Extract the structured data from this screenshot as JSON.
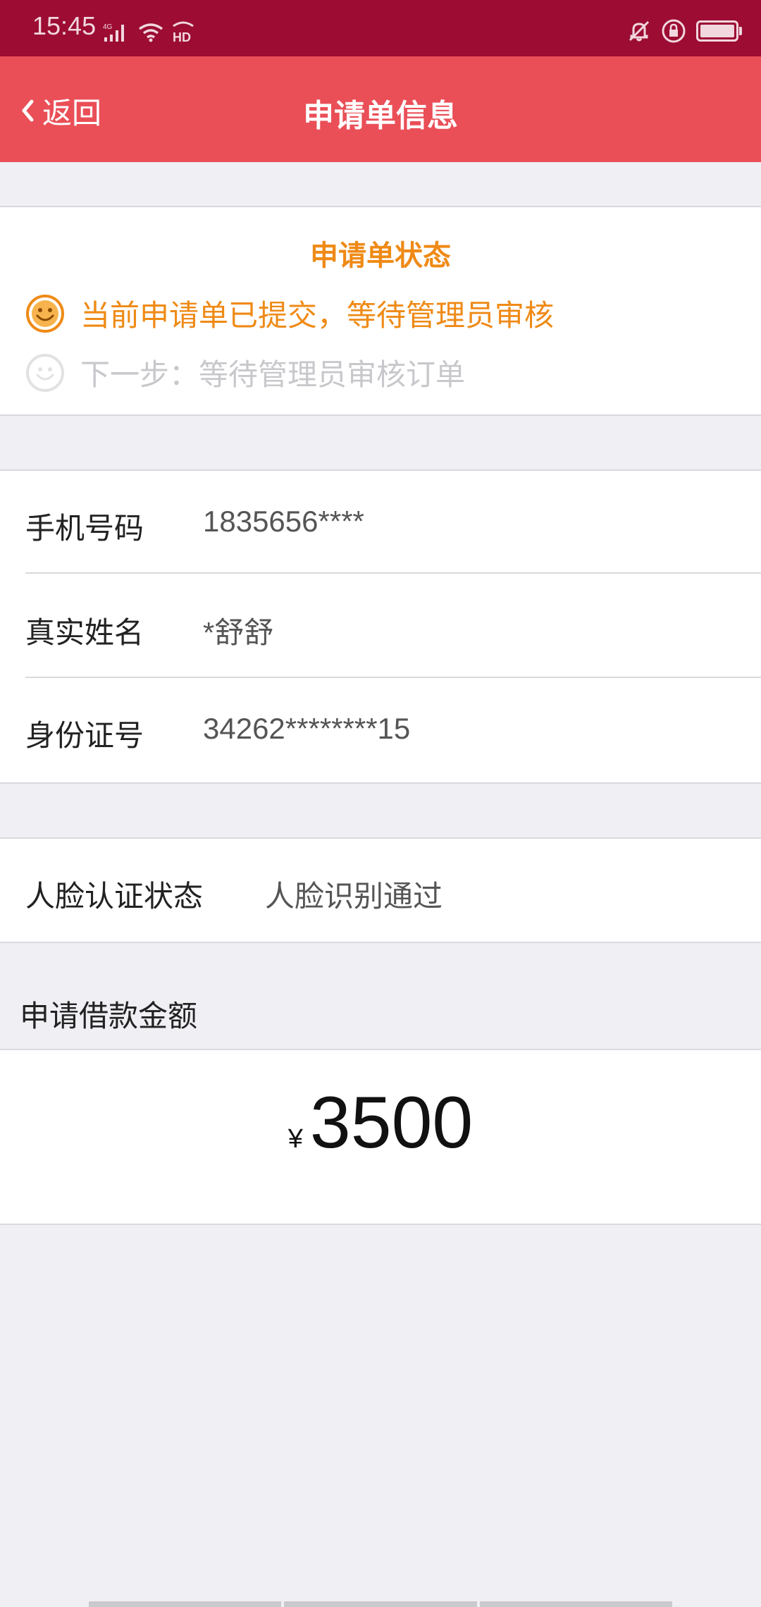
{
  "statusbar": {
    "time": "15:45",
    "network": "4G",
    "hd": "HD"
  },
  "nav": {
    "back_label": "返回",
    "title": "申请单信息"
  },
  "status_card": {
    "title": "申请单状态",
    "current": "当前申请单已提交，等待管理员审核",
    "next": "下一步：等待管理员审核订单"
  },
  "info": {
    "phone_label": "手机号码",
    "phone_value": "1835656****",
    "name_label": "真实姓名",
    "name_value": "*舒舒",
    "id_label": "身份证号",
    "id_value": "34262********15"
  },
  "face_auth": {
    "label": "人脸认证状态",
    "value": "人脸识别通过"
  },
  "loan": {
    "section_title": "申请借款金额",
    "currency": "¥",
    "amount": "3500"
  },
  "colors": {
    "statusbar": "#9c0c33",
    "navbar": "#ea4f57",
    "accent_orange": "#ef8a16"
  }
}
